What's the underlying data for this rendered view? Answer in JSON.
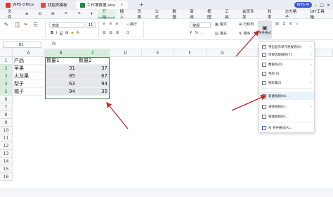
{
  "titlebar": {
    "tabs": [
      {
        "label": "WPS Office",
        "icon": "wps-logo-icon",
        "color": "#d9382a"
      },
      {
        "label": "找稻壳模板",
        "icon": "docer-icon",
        "color": "#e04a3a"
      },
      {
        "label": "工作簿数据.xlsx",
        "icon": "sheet-icon",
        "color": "#1f8a45",
        "close": "×"
      }
    ],
    "new_tab": "+",
    "ai_label": "WPS AI"
  },
  "menubar": {
    "items": [
      "文件",
      "≡",
      "⊡",
      "⊟",
      "↶",
      "↷",
      "▾",
      "开始",
      "插入",
      "页面",
      "公式",
      "数据",
      "审阅",
      "视图",
      "工具",
      "会员专享",
      "效率",
      "方方格子",
      "DIY工具箱"
    ],
    "active": "开始"
  },
  "ribbon": {
    "font_name": "宋体",
    "font_size": "11",
    "groups": [
      "格式刷",
      "粘贴",
      "剪切",
      "复制"
    ],
    "wrap_label": "换行",
    "numformat": "常规",
    "cond_format_label": "条件格式",
    "format_label": "格式",
    "rowcol_label": "行和列",
    "fill_label": "填充",
    "sort_label": "排序"
  },
  "formula_bar": {
    "cell_ref": "B2",
    "fx": "fx"
  },
  "grid": {
    "columns": [
      "A",
      "B",
      "C",
      "D",
      "E",
      "F",
      "G",
      "H"
    ],
    "rows": [
      "1",
      "2",
      "3",
      "4",
      "5",
      "6",
      "7",
      "8",
      "9",
      "10",
      "11",
      "12",
      "13",
      "14",
      "15",
      "16"
    ],
    "data": [
      [
        "产品",
        "数量1",
        "数量2"
      ],
      [
        "苹果",
        "31",
        "37"
      ],
      [
        "火龙果",
        "85",
        "67"
      ],
      [
        "梨子",
        "63",
        "94"
      ],
      [
        "橘子",
        "94",
        "35"
      ]
    ]
  },
  "dropdown": {
    "items": [
      {
        "label": "突出显示单元格规则(H)",
        "icon": "highlight-rule-icon",
        "chevron": "›"
      },
      {
        "label": "项目选取规则(T)",
        "icon": "top-bottom-icon",
        "chevron": "›"
      },
      {
        "label": "数据条(D)",
        "icon": "data-bars-icon",
        "chevron": "›"
      },
      {
        "label": "色阶(S)",
        "icon": "color-scale-icon",
        "chevron": "›"
      },
      {
        "label": "图标集(I)",
        "icon": "icon-sets-icon",
        "chevron": "›"
      },
      {
        "label": "新建规则(N)...",
        "icon": "new-rule-icon",
        "chevron": ""
      },
      {
        "label": "清除规则(C)",
        "icon": "clear-rule-icon",
        "chevron": "›"
      },
      {
        "label": "管理规则(R)...",
        "icon": "manage-rule-icon",
        "chevron": ""
      },
      {
        "label": "AI 条件格式(A)...",
        "icon": "ai-icon",
        "chevron": ""
      }
    ]
  },
  "colors": {
    "accent_green": "#117a3c",
    "arrow_red": "#c62828",
    "selection_border": "#2e8b3e"
  }
}
